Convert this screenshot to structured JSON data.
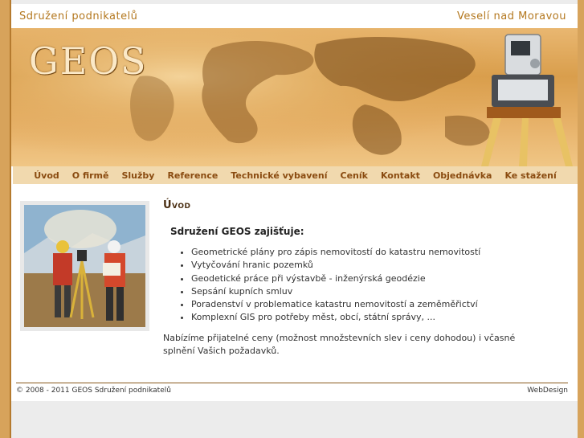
{
  "header": {
    "org_name": "Sdružení podnikatelů",
    "location": "Veselí nad Moravou",
    "logo_text": "GEOS"
  },
  "nav": {
    "items": [
      {
        "label": "Úvod"
      },
      {
        "label": "O firmě"
      },
      {
        "label": "Služby"
      },
      {
        "label": "Reference"
      },
      {
        "label": "Technické vybavení"
      },
      {
        "label": "Ceník"
      },
      {
        "label": "Kontakt"
      },
      {
        "label": "Objednávka"
      },
      {
        "label": "Ke stažení"
      }
    ]
  },
  "main": {
    "title": "Úvod",
    "subtitle": "Sdružení GEOS zajišťuje:",
    "services": [
      "Geometrické plány pro zápis nemovitostí do katastru nemovitostí",
      "Vytyčování hranic pozemků",
      "Geodetické práce při výstavbě - inženýrská geodézie",
      "Sepsání kupních smluv",
      "Poradenství v problematice katastru nemovitostí a zeměměřictví",
      "Komplexní GIS pro potřeby měst, obcí, státní správy, ..."
    ],
    "paragraph": "Nabízíme přijatelné ceny (možnost množstevních slev i ceny dohodou) i včasné splnění Vašich požadavků."
  },
  "footer": {
    "copyright": "© 2008 - 2011 GEOS Sdružení podnikatelů",
    "credit": "WebDesign"
  },
  "colors": {
    "accent": "#b4781f",
    "nav_bg": "#f1d9ae",
    "nav_text": "#8a4b10",
    "frame": "#d7a35b"
  }
}
